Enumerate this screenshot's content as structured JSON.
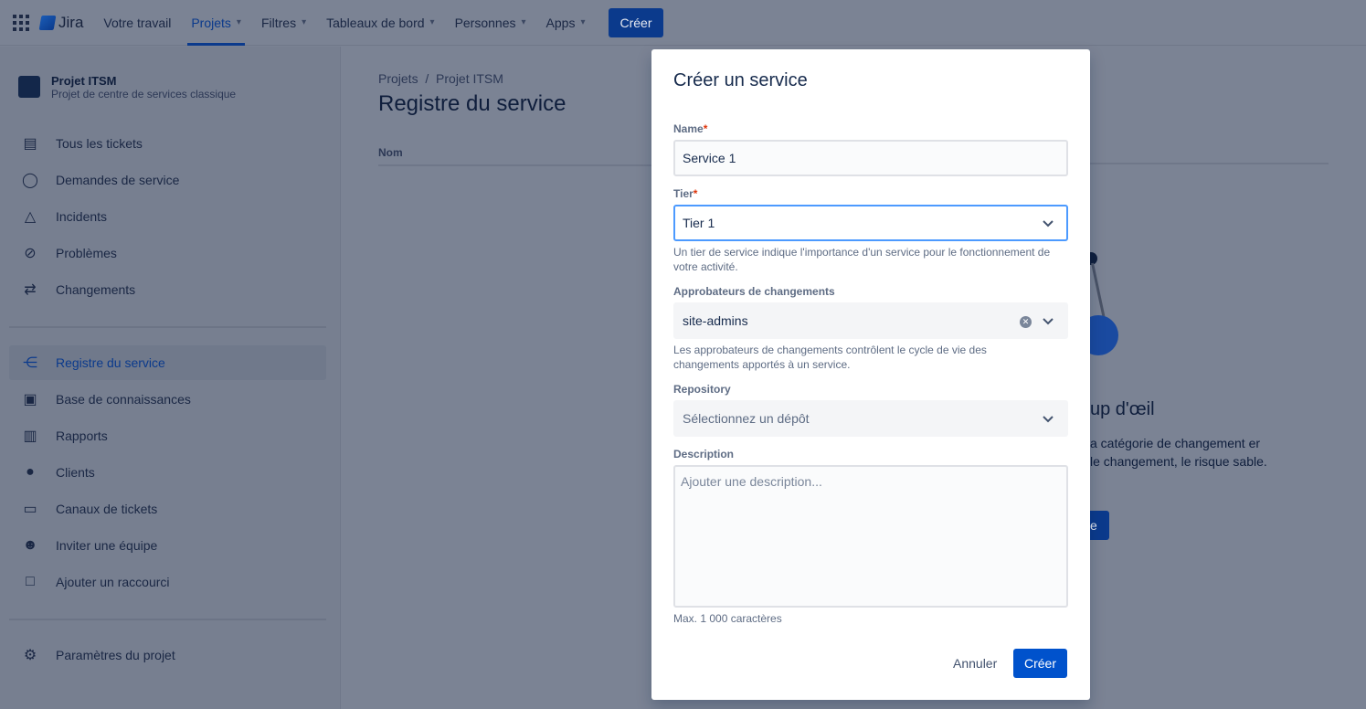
{
  "nav": {
    "logo": "Jira",
    "items": [
      {
        "label": "Votre travail"
      },
      {
        "label": "Projets"
      },
      {
        "label": "Filtres"
      },
      {
        "label": "Tableaux de bord"
      },
      {
        "label": "Personnes"
      },
      {
        "label": "Apps"
      }
    ],
    "create": "Créer"
  },
  "sidebar": {
    "project_name": "Projet ITSM",
    "project_type": "Projet de centre de services classique",
    "items": [
      {
        "label": "Tous les tickets",
        "icon": "list-icon"
      },
      {
        "label": "Demandes de service",
        "icon": "chat-icon"
      },
      {
        "label": "Incidents",
        "icon": "warning-icon"
      },
      {
        "label": "Problèmes",
        "icon": "block-icon"
      },
      {
        "label": "Changements",
        "icon": "changes-icon"
      },
      {
        "label": "Registre du service",
        "icon": "service-icon"
      },
      {
        "label": "Base de connaissances",
        "icon": "book-icon"
      },
      {
        "label": "Rapports",
        "icon": "chart-icon"
      },
      {
        "label": "Clients",
        "icon": "people-icon"
      },
      {
        "label": "Canaux de tickets",
        "icon": "monitor-icon"
      },
      {
        "label": "Inviter une équipe",
        "icon": "add-person-icon"
      },
      {
        "label": "Ajouter un raccourci",
        "icon": "add-shortcut-icon"
      },
      {
        "label": "Paramètres du projet",
        "icon": "gear-icon"
      }
    ]
  },
  "main": {
    "breadcrumb": [
      "Projets",
      "Projet ITSM"
    ],
    "title": "Registre du service",
    "column": "Nom",
    "empty_title": "up d'œil",
    "empty_text": "a catégorie de changement er le changement, le risque sable.",
    "empty_button": "e"
  },
  "modal": {
    "title": "Créer un service",
    "name": {
      "label": "Name",
      "value": "Service 1"
    },
    "tier": {
      "label": "Tier",
      "value": "Tier 1",
      "help": "Un tier de service indique l'importance d'un service pour le fonctionnement de votre activité."
    },
    "approvers": {
      "label": "Approbateurs de changements",
      "value": "site-admins",
      "help": "Les approbateurs de changements contrôlent le cycle de vie des changements apportés à un service."
    },
    "repository": {
      "label": "Repository",
      "placeholder": "Sélectionnez un dépôt"
    },
    "description": {
      "label": "Description",
      "placeholder": "Ajouter une description...",
      "help": "Max. 1 000 caractères"
    },
    "cancel": "Annuler",
    "create": "Créer"
  }
}
